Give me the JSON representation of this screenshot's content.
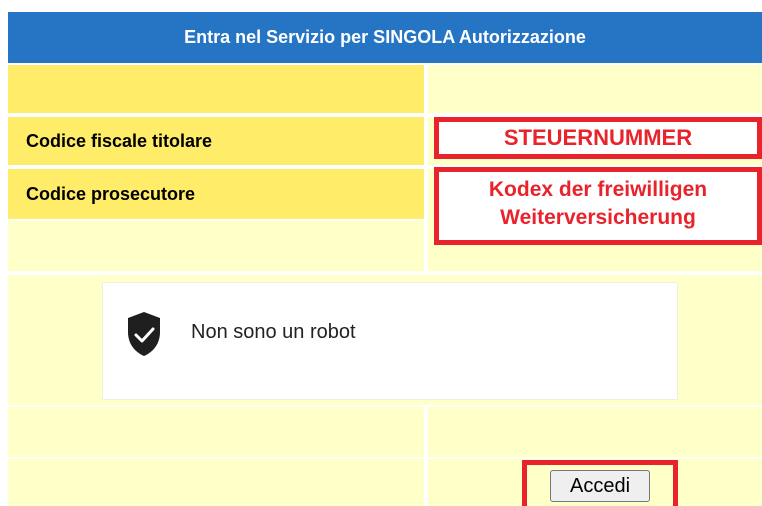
{
  "form": {
    "title": "Entra nel Servizio per SINGOLA Autorizzazione",
    "fields": [
      {
        "label": "Codice fiscale titolare",
        "annotation": "STEUERNUMMER"
      },
      {
        "label": "Codice prosecutore",
        "annotation_line1": "Kodex der freiwilligen",
        "annotation_line2": "Weiterversicherung"
      }
    ],
    "captcha": {
      "label": "Non sono un robot",
      "icon": "shield-check-icon"
    },
    "submit_label": "Accedi"
  },
  "colors": {
    "header_bg": "#2575c4",
    "label_bg": "#ffed6a",
    "row_bg": "#ffffc8",
    "annotation_red": "#e8232b"
  }
}
